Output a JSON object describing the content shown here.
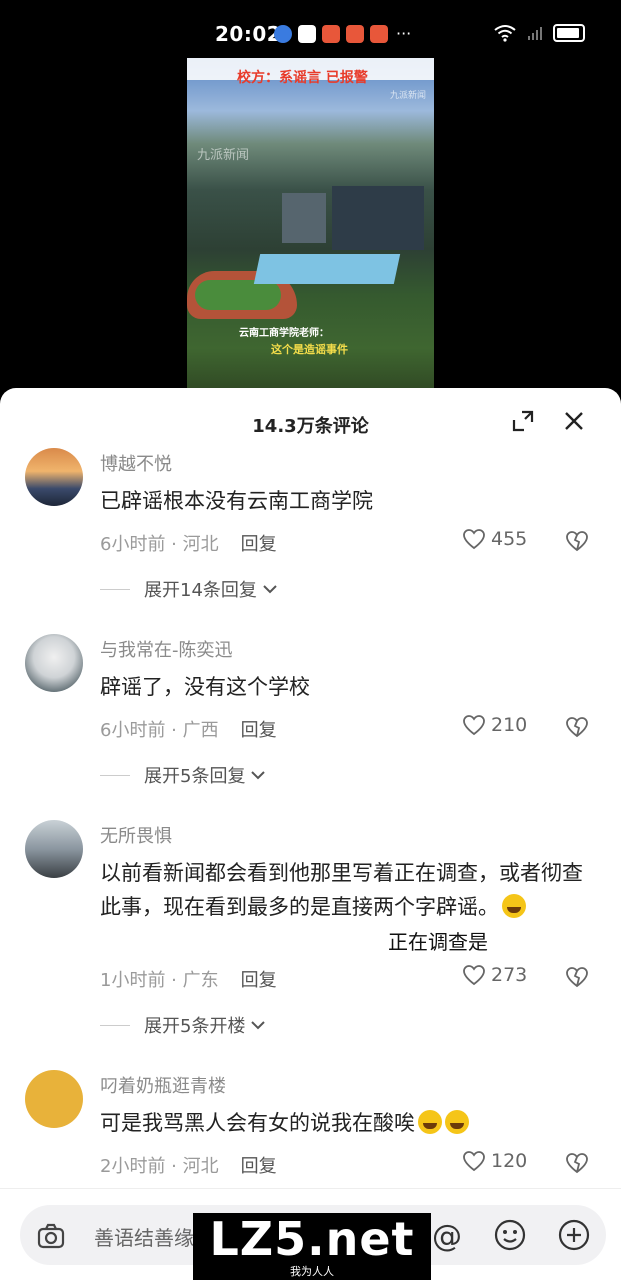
{
  "status_bar": {
    "time": "20:02",
    "more": "···"
  },
  "video": {
    "caption_line2": "校方：系谣言 已报警",
    "watermark": "九派新闻",
    "corner_tag": "九派新闻",
    "subtitle_1": "云南工商学院老师：",
    "subtitle_2": "这个是造谣事件"
  },
  "sheet": {
    "title": "14.3万条评论"
  },
  "comments": [
    {
      "username": "博越不悦",
      "text": "已辟谣根本没有云南工商学院",
      "time": "6小时前",
      "location": "河北",
      "reply": "回复",
      "likes": "455",
      "expand": "展开14条回复"
    },
    {
      "username": "与我常在-陈奕迅",
      "text": "辟谣了，没有这个学校",
      "time": "6小时前",
      "location": "广西",
      "reply": "回复",
      "likes": "210",
      "expand": "展开5条回复"
    },
    {
      "username": "无所畏惧",
      "text": "以前看新闻都会看到他那里写着正在调查，或者彻查此事，现在看到最多的是直接两个字辟谣。",
      "time": "1小时前",
      "location": "广东",
      "reply": "回复",
      "likes": "273",
      "expand": "展开5条开楼"
    },
    {
      "username": "叼着奶瓶逛青楼",
      "text": "可是我骂黑人会有女的说我在酸唉",
      "time": "2小时前",
      "location": "河北",
      "reply": "回复",
      "likes": "120"
    }
  ],
  "overlay_text": "正在调查是",
  "input": {
    "placeholder": "善语结善缘"
  },
  "watermark": {
    "main": "LZ5.net",
    "sub": "我为人人"
  },
  "colors": {
    "sheet_bg": "#ffffff",
    "caption_red": "#e83b2a",
    "subtitle_yellow": "#f3dc4a"
  }
}
